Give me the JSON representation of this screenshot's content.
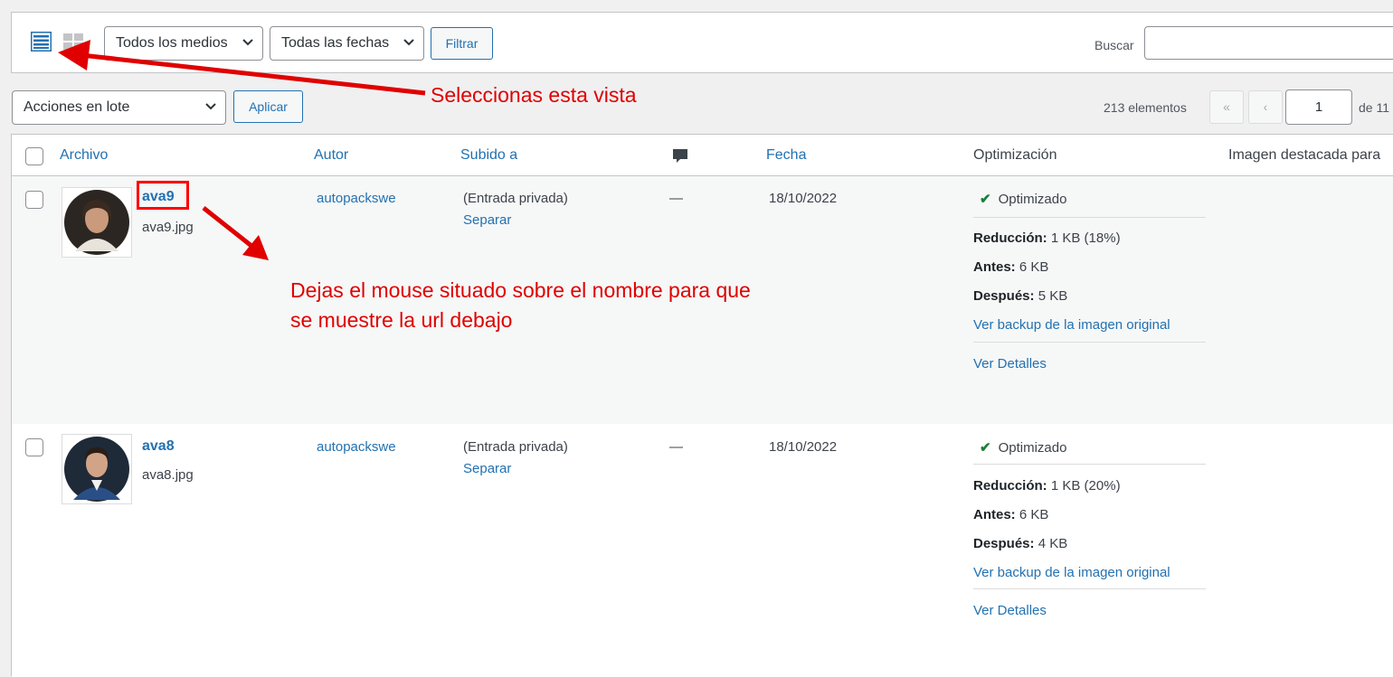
{
  "toolbar": {
    "media_filter": "Todos los medios",
    "date_filter": "Todas las fechas",
    "filter_button": "Filtrar",
    "search_label": "Buscar",
    "search_value": ""
  },
  "bulk": {
    "actions_select": "Acciones en lote",
    "apply_button": "Aplicar"
  },
  "pagination": {
    "items_count": "213 elementos",
    "first": "«",
    "prev": "‹",
    "current_page": "1",
    "total_label": "de 11"
  },
  "table": {
    "columns": [
      "Archivo",
      "Autor",
      "Subido a",
      "comment-icon",
      "Fecha",
      "Optimización",
      "Imagen destacada para"
    ],
    "rows": [
      {
        "title": "ava9",
        "filename": "ava9.jpg",
        "author": "autopackswe",
        "uploaded_to": "(Entrada privada)",
        "detach": "Separar",
        "comments": "—",
        "date": "18/10/2022",
        "opt_status": "Optimizado",
        "reduction_label": "Reducción:",
        "reduction_value": "1 KB (18%)",
        "before_label": "Antes:",
        "before_value": "6 KB",
        "after_label": "Después:",
        "after_value": "5 KB",
        "backup_link": "Ver backup de la imagen original",
        "details_link": "Ver Detalles"
      },
      {
        "title": "ava8",
        "filename": "ava8.jpg",
        "author": "autopackswe",
        "uploaded_to": "(Entrada privada)",
        "detach": "Separar",
        "comments": "—",
        "date": "18/10/2022",
        "opt_status": "Optimizado",
        "reduction_label": "Reducción:",
        "reduction_value": "1 KB (20%)",
        "before_label": "Antes:",
        "before_value": "6 KB",
        "after_label": "Después:",
        "after_value": "4 KB",
        "backup_link": "Ver backup de la imagen original",
        "details_link": "Ver Detalles"
      }
    ]
  },
  "annotations": {
    "view_note": "Seleccionas esta vista",
    "hover_note_line1": "Dejas el mouse situado sobre el nombre para que",
    "hover_note_line2": "se muestre la url debajo"
  },
  "colors": {
    "link": "#2271b1",
    "annotation": "#e00000",
    "success": "#1a7f37"
  }
}
